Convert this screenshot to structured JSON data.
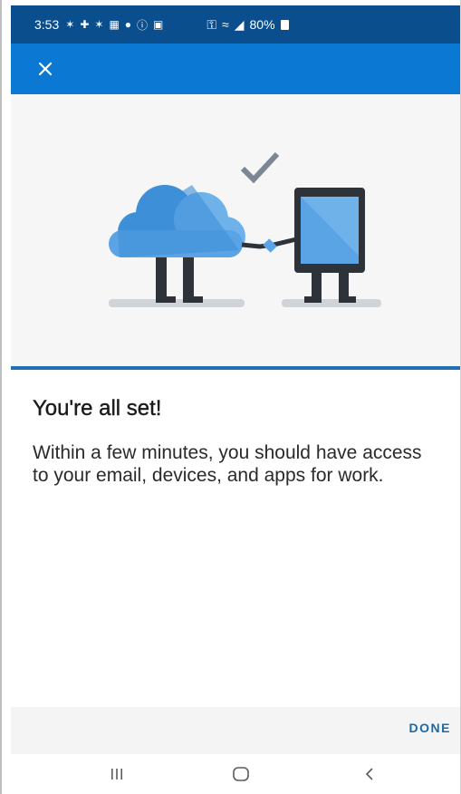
{
  "status_bar": {
    "time": "3:53",
    "battery": "80%",
    "icons": [
      "notification-icon",
      "shield-icon",
      "notification-icon",
      "gallery-icon",
      "location-icon",
      "info-icon",
      "app-icon",
      "key-icon",
      "wifi-icon",
      "signal-icon",
      "battery-icon"
    ]
  },
  "app_bar": {
    "close_icon": "close-icon"
  },
  "content": {
    "heading": "You're all set!",
    "message": "Within a few minutes, you should have access to your email, devices, and apps for work."
  },
  "footer": {
    "done_label": "DONE"
  },
  "nav_bar": {
    "icons": [
      "recents-icon",
      "home-icon",
      "back-icon"
    ]
  },
  "colors": {
    "status_bar": "#0a4e8e",
    "app_bar": "#0b78d3",
    "accent": "#1b6aa8",
    "divider": "#1f6fb5"
  }
}
